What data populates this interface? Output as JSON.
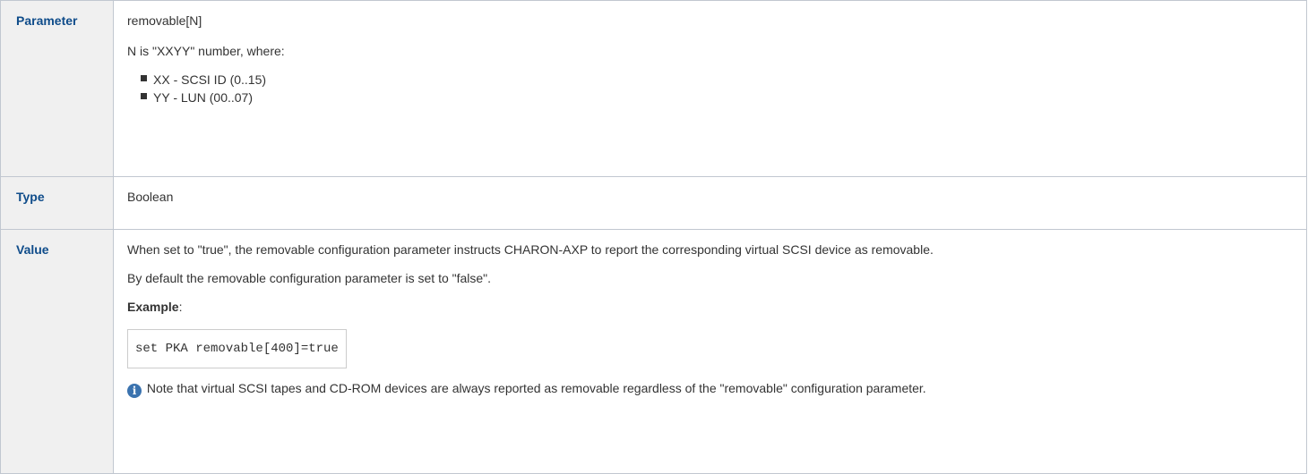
{
  "table": {
    "parameter": {
      "header": "Parameter",
      "name": "removable[N]",
      "desc": "N is \"XXYY\" number, where:",
      "items": [
        "XX - SCSI ID (0..15)",
        "YY - LUN (00..07)"
      ]
    },
    "type": {
      "header": "Type",
      "value": "Boolean"
    },
    "value": {
      "header": "Value",
      "p1": "When set to \"true\", the removable configuration parameter instructs CHARON-AXP to report the corresponding virtual SCSI device as removable.",
      "p2": "By default the removable configuration parameter is set to \"false\".",
      "example_label": "Example",
      "example_suffix": ":",
      "code": "set PKA removable[400]=true",
      "note_icon": "info-icon",
      "note": "Note that virtual SCSI tapes and CD-ROM devices are always reported as removable regardless of the \"removable\" configuration parameter."
    }
  },
  "colors": {
    "header_bg": "#f0f0f0",
    "header_text": "#0f4c8a",
    "border": "#c1c7d0",
    "info_icon": "#3b73af"
  }
}
